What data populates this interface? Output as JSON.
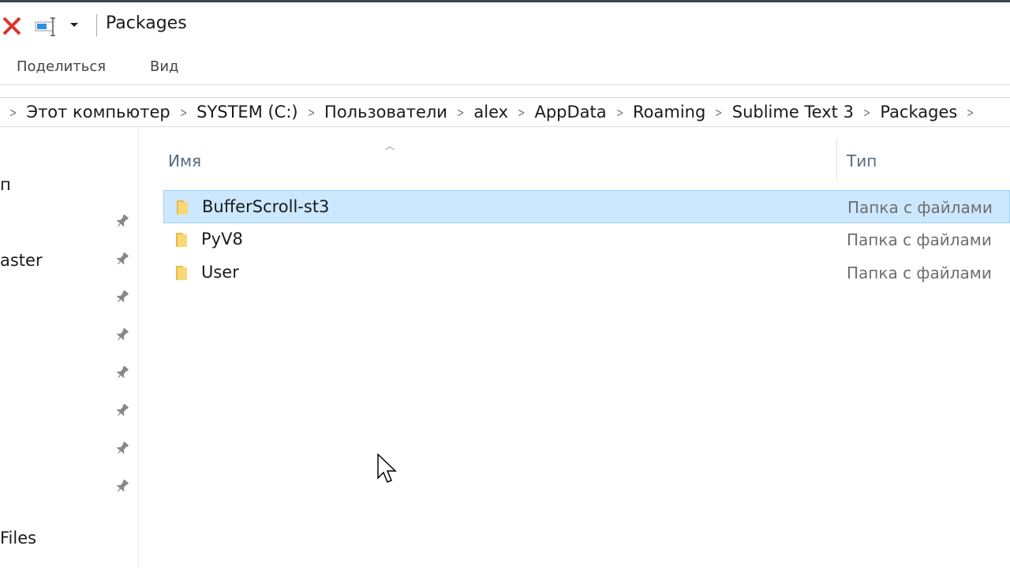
{
  "window": {
    "title": "Packages"
  },
  "ribbon": {
    "tabs": [
      "Поделиться",
      "Вид"
    ]
  },
  "address": {
    "crumbs": [
      "Этот компьютер",
      "SYSTEM (C:)",
      "Пользователи",
      "alex",
      "AppData",
      "Roaming",
      "Sublime Text 3",
      "Packages"
    ]
  },
  "sidebar": {
    "items": [
      "п",
      "aster",
      "Files"
    ],
    "pins": 8
  },
  "columns": {
    "name": "Имя",
    "type": "Тип"
  },
  "files": [
    {
      "name": "BufferScroll-st3",
      "type": "Папка с файлами",
      "selected": true
    },
    {
      "name": "PyV8",
      "type": "Папка с файлами",
      "selected": false
    },
    {
      "name": "User",
      "type": "Папка с файлами",
      "selected": false
    }
  ],
  "colors": {
    "selection": "#cce8ff",
    "folder": "#f8d775",
    "close": "#e0322a"
  }
}
